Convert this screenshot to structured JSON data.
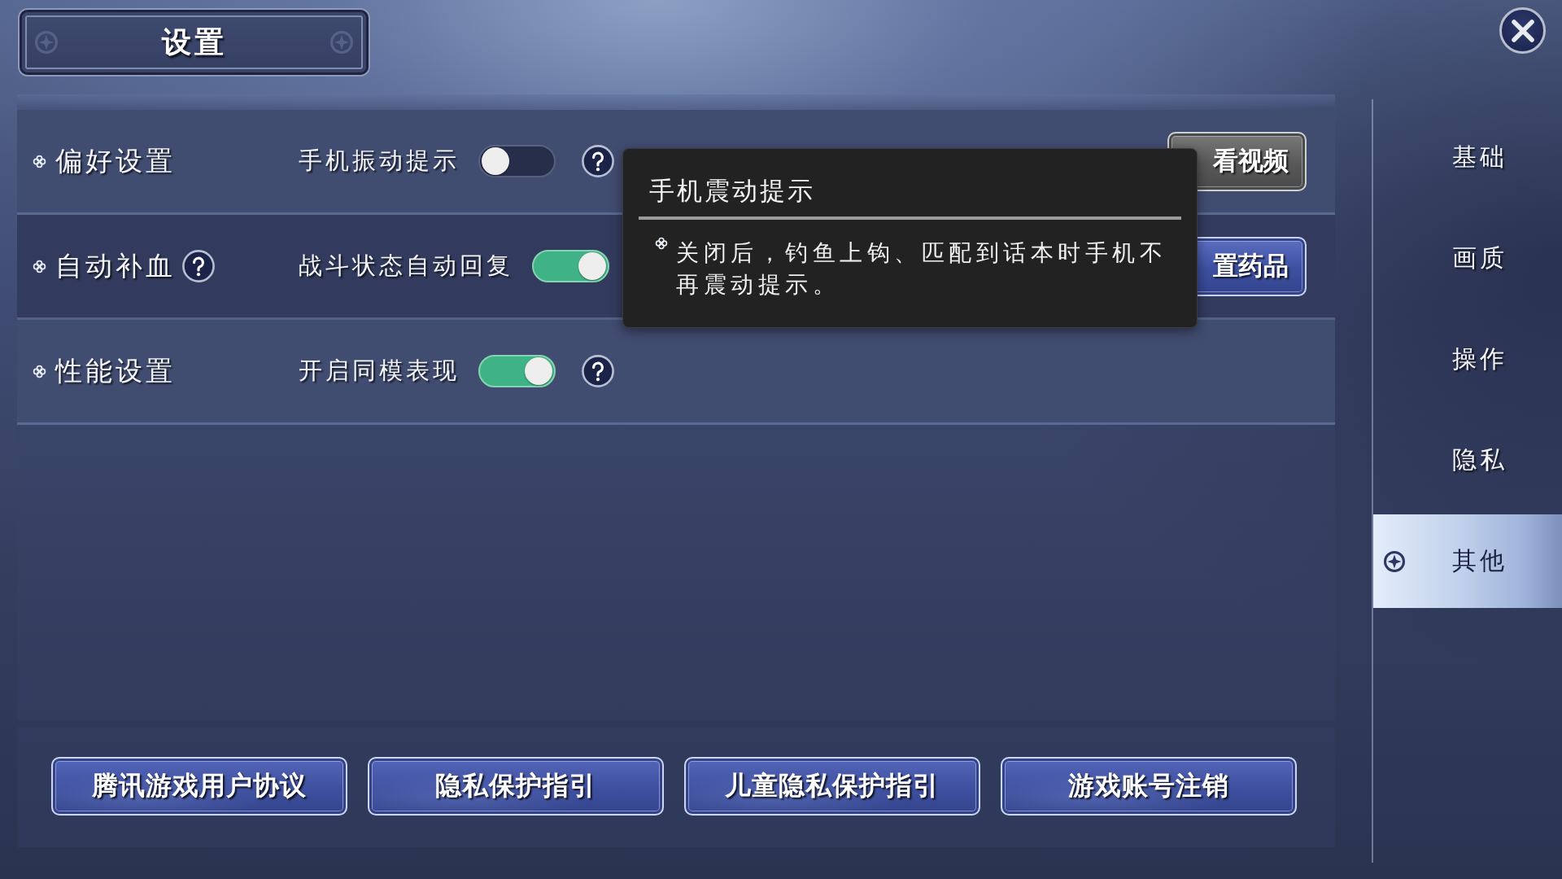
{
  "title": "设置",
  "settings_rows": [
    {
      "category": "偏好设置",
      "category_help": false,
      "option": "手机振动提示",
      "on": false,
      "option_help": true,
      "action": {
        "kind": "secondary",
        "label": "看视频"
      }
    },
    {
      "category": "自动补血",
      "category_help": true,
      "option": "战斗状态自动回复",
      "on": true,
      "option_help": false,
      "action": {
        "kind": "primary",
        "label": "置药品"
      }
    },
    {
      "category": "性能设置",
      "category_help": false,
      "option": "开启同模表现",
      "on": true,
      "option_help": true
    }
  ],
  "tooltip": {
    "title": "手机震动提示",
    "text": "关闭后，钓鱼上钩、匹配到话本时手机不再震动提示。"
  },
  "sidebar": {
    "items": [
      {
        "label": "基础",
        "selected": false
      },
      {
        "label": "画质",
        "selected": false
      },
      {
        "label": "操作",
        "selected": false
      },
      {
        "label": "隐私",
        "selected": false
      },
      {
        "label": "其他",
        "selected": true
      }
    ]
  },
  "footer_buttons": [
    "腾讯游戏用户协议",
    "隐私保护指引",
    "儿童隐私保护指引",
    "游戏账号注销"
  ]
}
